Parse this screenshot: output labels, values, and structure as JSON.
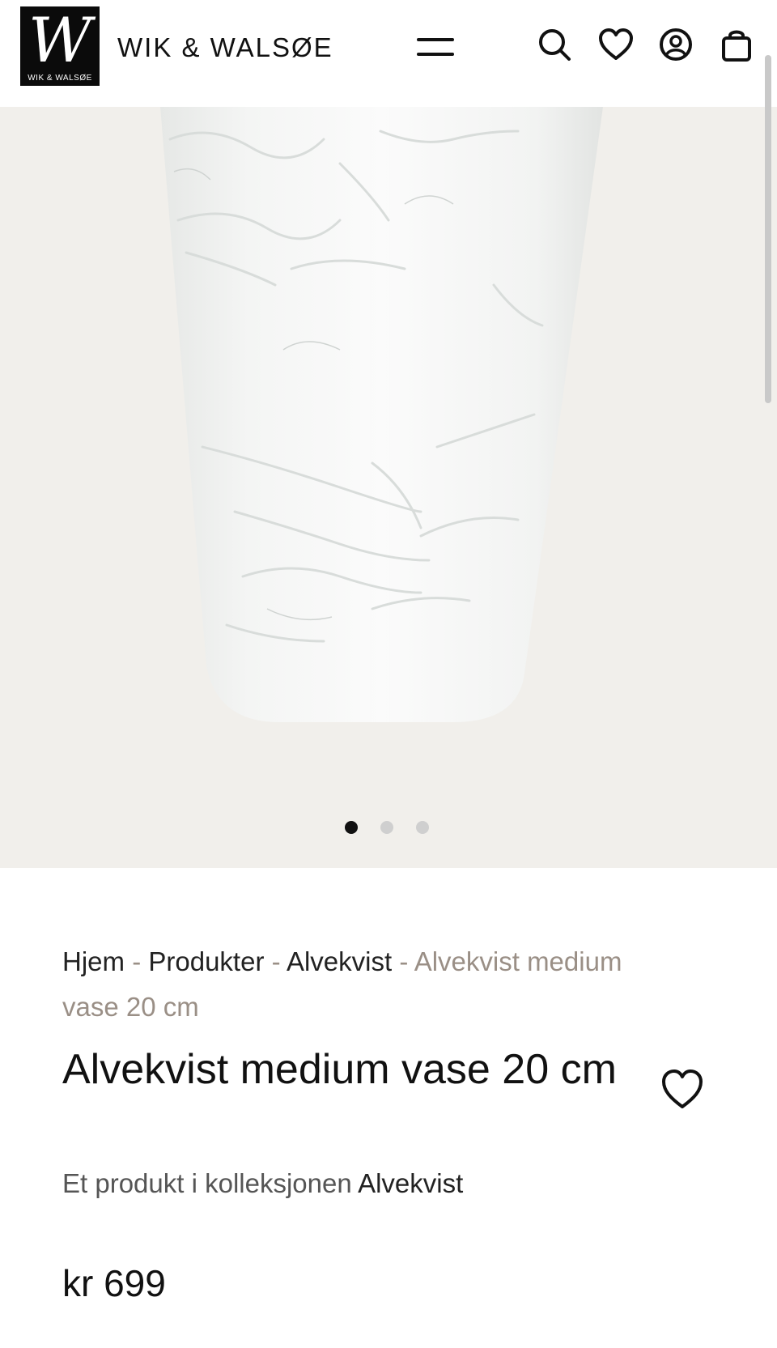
{
  "header": {
    "logo_letter": "W",
    "logo_small_text": "WIK & WALSØE",
    "brand_name": "WIK & WALSØE"
  },
  "gallery": {
    "image_alt": "Alvekvist medium vase 20 cm",
    "slide_count": 3,
    "active_slide": 1
  },
  "breadcrumb": {
    "items": [
      "Hjem",
      "Produkter",
      "Alvekvist"
    ],
    "separator": "-",
    "current": "Alvekvist medium vase 20 cm"
  },
  "product": {
    "title": "Alvekvist medium vase 20 cm",
    "collection_prefix": "Et produkt i kolleksjonen",
    "collection_name": "Alvekvist",
    "price": "kr 699"
  },
  "icons": {
    "menu": "hamburger-icon",
    "search": "search-icon",
    "wishlist": "heart-icon",
    "account": "user-icon",
    "cart": "shopping-bag-icon"
  },
  "colors": {
    "background": "#ffffff",
    "hero_background": "#f1efeb",
    "text": "#111111",
    "muted": "#9a8f86",
    "logo_bg": "#0b0b0b"
  }
}
